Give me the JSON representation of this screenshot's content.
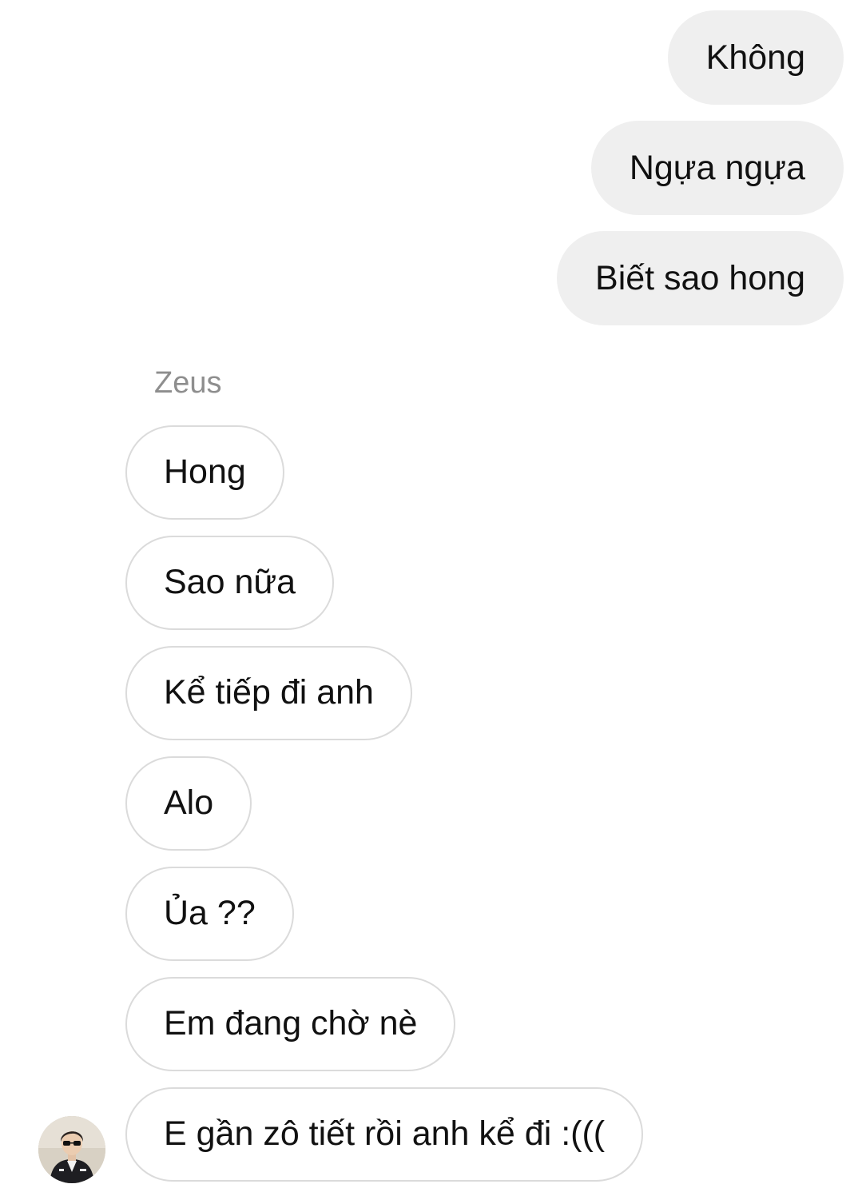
{
  "sent_messages": [
    {
      "text": "Không"
    },
    {
      "text": "Ngựa ngựa"
    },
    {
      "text": "Biết sao hong"
    }
  ],
  "sender": {
    "name": "Zeus"
  },
  "received_messages": [
    {
      "text": "Hong"
    },
    {
      "text": "Sao nữa"
    },
    {
      "text": "Kể tiếp đi anh"
    },
    {
      "text": "Alo"
    },
    {
      "text": "Ủa ??"
    },
    {
      "text": "Em đang chờ nè"
    },
    {
      "text": "E gần zô tiết rồi anh kể đi :((("
    }
  ],
  "colors": {
    "sent_bubble": "#efefef",
    "received_border": "#dbdbdb",
    "sender_name": "#8e8e8e",
    "text": "#111111"
  }
}
